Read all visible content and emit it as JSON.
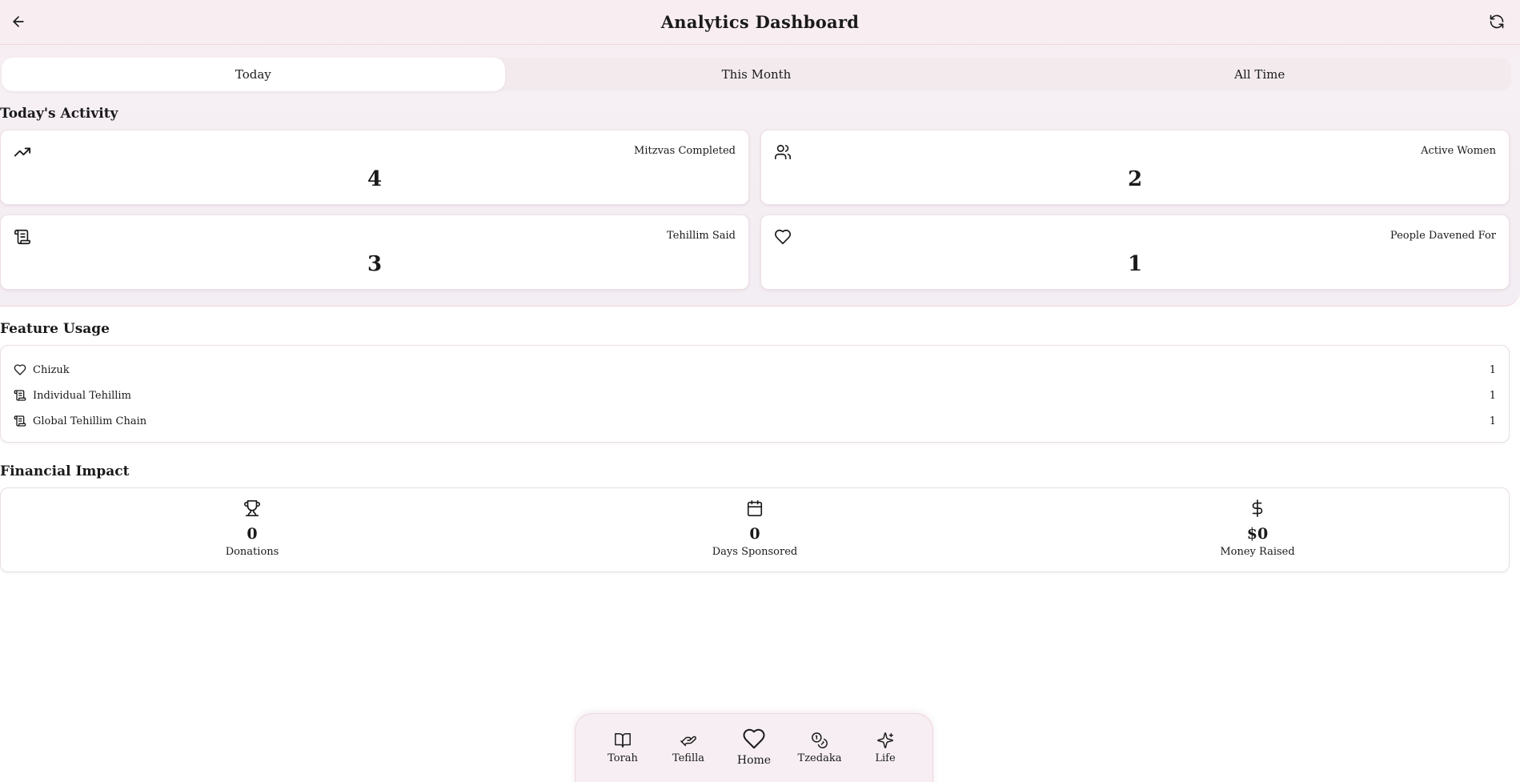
{
  "header": {
    "title": "Analytics Dashboard",
    "back_icon": "arrow-left-icon",
    "refresh_icon": "refresh-icon"
  },
  "tabs": [
    {
      "label": "Today",
      "active": true
    },
    {
      "label": "This Month",
      "active": false
    },
    {
      "label": "All Time",
      "active": false
    }
  ],
  "activity": {
    "title": "Today's Activity",
    "stats": [
      {
        "label": "Mitzvas Completed",
        "value": "4",
        "icon": "trending-up-icon"
      },
      {
        "label": "Active Women",
        "value": "2",
        "icon": "users-icon"
      },
      {
        "label": "Tehillim Said",
        "value": "3",
        "icon": "scroll-icon"
      },
      {
        "label": "People Davened For",
        "value": "1",
        "icon": "heart-icon"
      }
    ]
  },
  "features": {
    "title": "Feature Usage",
    "items": [
      {
        "name": "Chizuk",
        "count": "1",
        "icon": "heart-icon"
      },
      {
        "name": "Individual Tehillim",
        "count": "1",
        "icon": "scroll-icon"
      },
      {
        "name": "Global Tehillim Chain",
        "count": "1",
        "icon": "scroll-icon"
      }
    ]
  },
  "financial": {
    "title": "Financial Impact",
    "items": [
      {
        "label": "Donations",
        "value": "0",
        "icon": "trophy-icon"
      },
      {
        "label": "Days Sponsored",
        "value": "0",
        "icon": "calendar-icon"
      },
      {
        "label": "Money Raised",
        "value": "$0",
        "icon": "dollar-icon"
      }
    ]
  },
  "nav": {
    "items": [
      {
        "label": "Torah",
        "icon": "book-open-icon"
      },
      {
        "label": "Tefilla",
        "icon": "praying-hands-icon"
      },
      {
        "label": "Home",
        "icon": "heart-icon"
      },
      {
        "label": "Tzedaka",
        "icon": "coins-icon"
      },
      {
        "label": "Life",
        "icon": "sparkles-icon"
      }
    ]
  }
}
